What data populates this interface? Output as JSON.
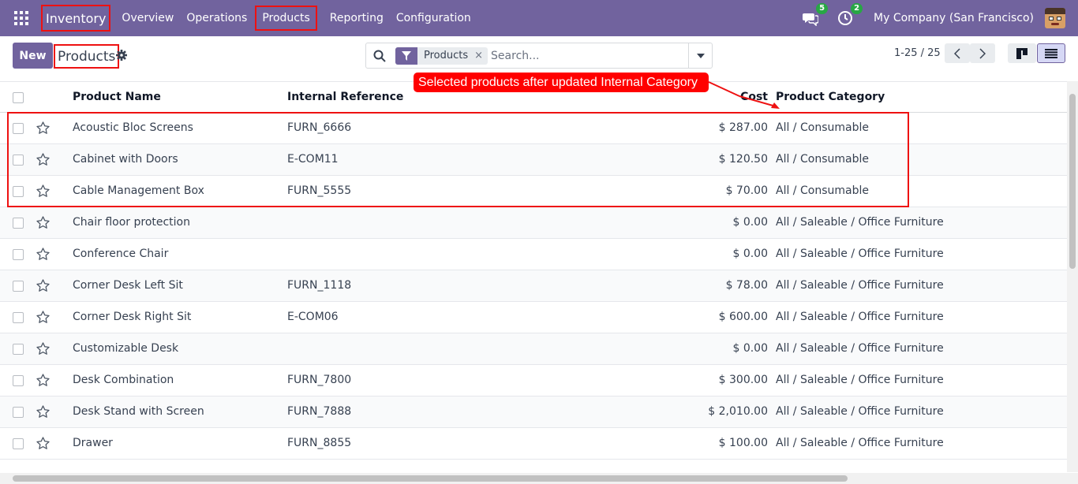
{
  "navbar": {
    "app_name": "Inventory",
    "menu": [
      "Overview",
      "Operations",
      "Products",
      "Reporting",
      "Configuration"
    ],
    "messages_count": "5",
    "activities_count": "2",
    "company": "My Company (San Francisco)"
  },
  "control": {
    "new_label": "New",
    "breadcrumb": "Products",
    "facet_label": "Products",
    "facet_remove": "×",
    "search_placeholder": "Search...",
    "pager": "1-25 / 25"
  },
  "annotation": {
    "callout": "Selected products after updated Internal Category"
  },
  "table": {
    "headers": {
      "name": "Product Name",
      "ref": "Internal Reference",
      "cost": "Cost",
      "category": "Product Category"
    },
    "rows": [
      {
        "name": "Acoustic Bloc Screens",
        "ref": "FURN_6666",
        "cost": "$ 287.00",
        "category": "All / Consumable"
      },
      {
        "name": "Cabinet with Doors",
        "ref": "E-COM11",
        "cost": "$ 120.50",
        "category": "All / Consumable"
      },
      {
        "name": "Cable Management Box",
        "ref": "FURN_5555",
        "cost": "$ 70.00",
        "category": "All / Consumable"
      },
      {
        "name": "Chair floor protection",
        "ref": "",
        "cost": "$ 0.00",
        "category": "All / Saleable / Office Furniture"
      },
      {
        "name": "Conference Chair",
        "ref": "",
        "cost": "$ 0.00",
        "category": "All / Saleable / Office Furniture"
      },
      {
        "name": "Corner Desk Left Sit",
        "ref": "FURN_1118",
        "cost": "$ 78.00",
        "category": "All / Saleable / Office Furniture"
      },
      {
        "name": "Corner Desk Right Sit",
        "ref": "E-COM06",
        "cost": "$ 600.00",
        "category": "All / Saleable / Office Furniture"
      },
      {
        "name": "Customizable Desk",
        "ref": "",
        "cost": "$ 0.00",
        "category": "All / Saleable / Office Furniture"
      },
      {
        "name": "Desk Combination",
        "ref": "FURN_7800",
        "cost": "$ 300.00",
        "category": "All / Saleable / Office Furniture"
      },
      {
        "name": "Desk Stand with Screen",
        "ref": "FURN_7888",
        "cost": "$ 2,010.00",
        "category": "All / Saleable / Office Furniture"
      },
      {
        "name": "Drawer",
        "ref": "FURN_8855",
        "cost": "$ 100.00",
        "category": "All / Saleable / Office Furniture"
      }
    ]
  },
  "colors": {
    "brand": "#71639e",
    "annotation": "#ff0000",
    "badge": "#28a745"
  }
}
